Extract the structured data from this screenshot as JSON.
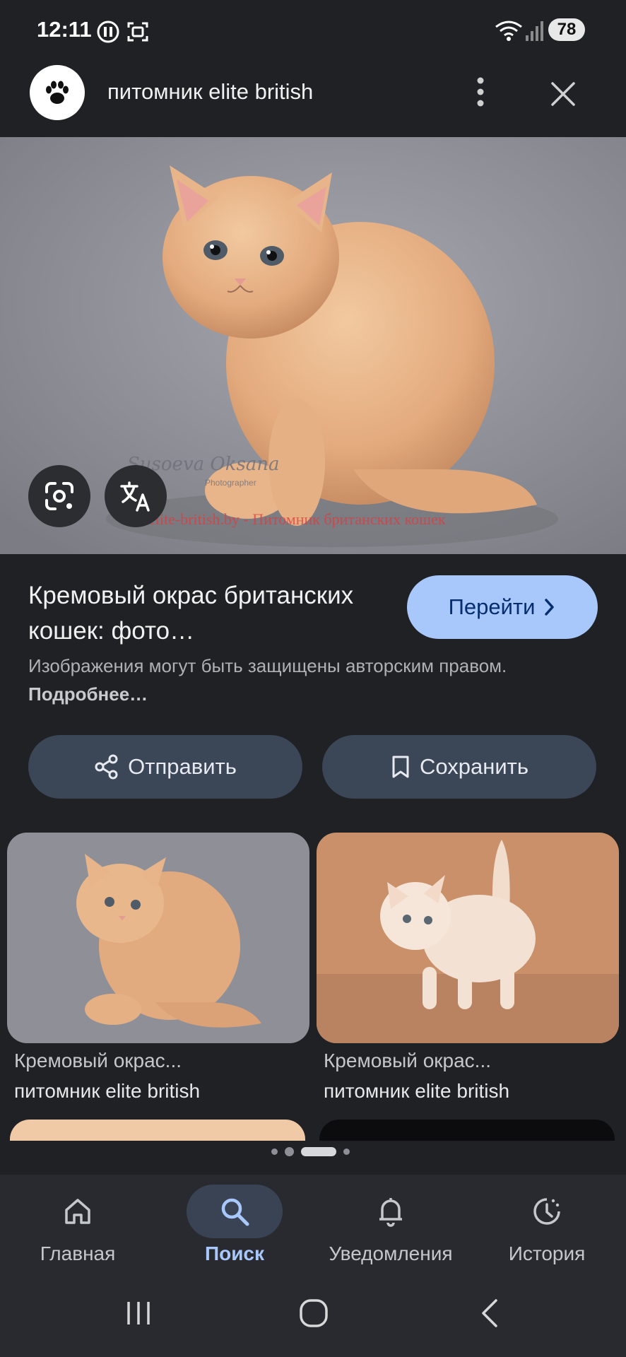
{
  "status_bar": {
    "time": "12:11",
    "battery": "78",
    "icons": [
      "media-icon",
      "screenshot-icon",
      "wifi-icon",
      "signal-icon",
      "battery-icon"
    ]
  },
  "header": {
    "title": "питомник elite british",
    "logo_icon": "paw-icon",
    "menu_icon": "more-vert-icon",
    "close_icon": "close-icon"
  },
  "main_image": {
    "watermark_signature": "Susoeva Oksana",
    "watermark_sub": "Photographer",
    "watermark_text": "elite-british.by - Питомник британских кошек",
    "lens_icon": "google-lens-icon",
    "translate_icon": "translate-icon"
  },
  "result": {
    "title": "Кремовый окрас британских кошек: фото…",
    "go_label": "Перейти",
    "copyright_prefix": "Изображения могут быть защищены авторским правом.",
    "copyright_link": "Подробнее…"
  },
  "actions": {
    "share_label": "Отправить",
    "save_label": "Сохранить"
  },
  "related": [
    {
      "caption": "Кремовый окрас...",
      "source": "питомник elite british"
    },
    {
      "caption": "Кремовый окрас...",
      "source": "питомник elite british"
    }
  ],
  "bottom_nav": [
    {
      "label": "Главная",
      "icon": "home-icon"
    },
    {
      "label": "Поиск",
      "icon": "search-icon",
      "active": true
    },
    {
      "label": "Уведомления",
      "icon": "bell-icon"
    },
    {
      "label": "История",
      "icon": "history-icon"
    }
  ],
  "colors": {
    "background": "#1f2125",
    "accent": "#a8c7fa",
    "button": "#3b4656"
  }
}
